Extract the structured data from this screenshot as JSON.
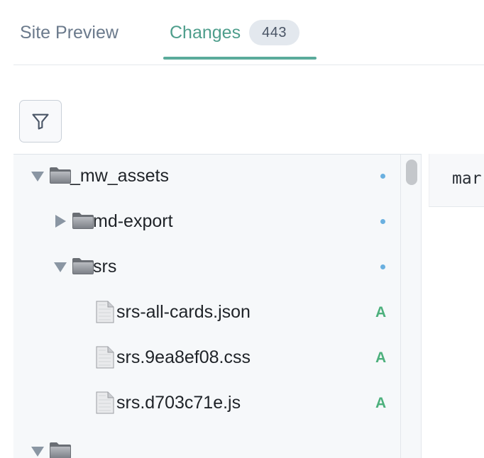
{
  "tabs": {
    "site_preview": "Site Preview",
    "changes": "Changes",
    "changes_count": "443"
  },
  "toolbar": {
    "filter_icon": "filter-icon"
  },
  "tree": {
    "rows": [
      {
        "type": "folder",
        "name": "_mw_assets",
        "expanded": true,
        "status": "dot"
      },
      {
        "type": "folder",
        "name": "md-export",
        "expanded": false,
        "status": "dot"
      },
      {
        "type": "folder",
        "name": "srs",
        "expanded": true,
        "status": "dot"
      },
      {
        "type": "file",
        "name": "srs-all-cards.json",
        "status": "A"
      },
      {
        "type": "file",
        "name": "srs.9ea8ef08.css",
        "status": "A"
      },
      {
        "type": "file",
        "name": "srs.d703c71e.js",
        "status": "A"
      }
    ]
  },
  "preview": {
    "header_text": "mar"
  },
  "colors": {
    "accent": "#4e9e8c",
    "added": "#4cb07c",
    "modified_dot": "#6ab0e0"
  }
}
